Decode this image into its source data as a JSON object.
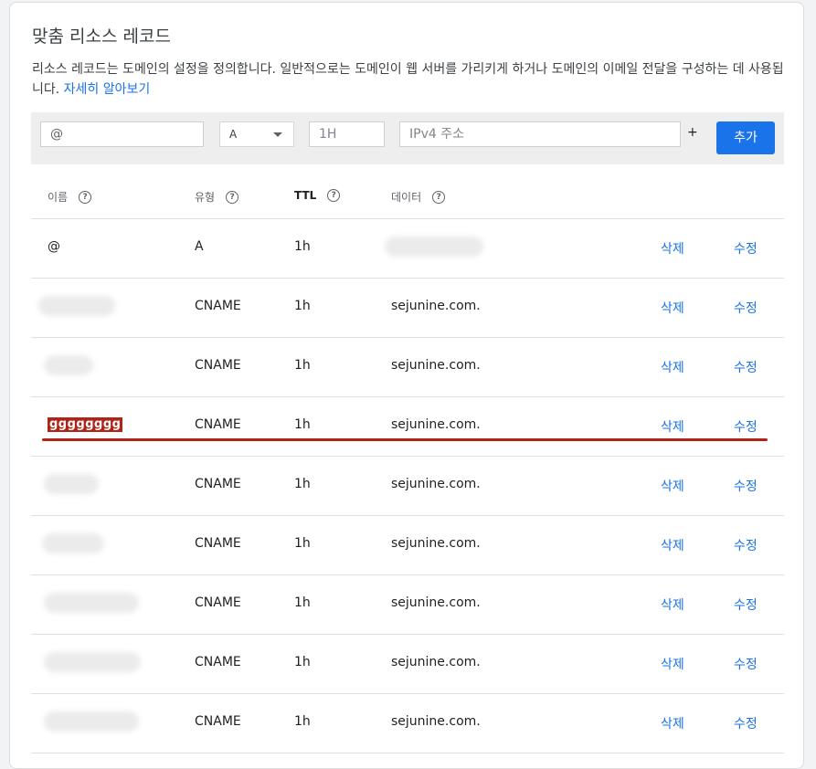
{
  "header": {
    "title": "맞춤 리소스 레코드",
    "description": "리소스 레코드는 도메인의 설정을 정의합니다. 일반적으로는 도메인이 웹 서버를 가리키게 하거나 도메인의 이메일 전달을 구성하는 데 사용됩니다.",
    "learn_more": "자세히 알아보기"
  },
  "form": {
    "name_value": "@",
    "type_value": "A",
    "ttl_placeholder": "1H",
    "data_placeholder": "IPv4 주소",
    "plus_label": "+",
    "add_label": "추가"
  },
  "columns": {
    "name": "이름",
    "type": "유형",
    "ttl": "TTL",
    "data": "데이터",
    "help_glyph": "?"
  },
  "actions": {
    "delete": "삭제",
    "edit": "수정"
  },
  "records": [
    {
      "name": "@",
      "type": "A",
      "ttl": "1h",
      "data": ""
    },
    {
      "name": "",
      "type": "CNAME",
      "ttl": "1h",
      "data": "sejunine.com."
    },
    {
      "name": "",
      "type": "CNAME",
      "ttl": "1h",
      "data": "sejunine.com."
    },
    {
      "name": "gggggggg",
      "type": "CNAME",
      "ttl": "1h",
      "data": "sejunine.com."
    },
    {
      "name": "",
      "type": "CNAME",
      "ttl": "1h",
      "data": "sejunine.com."
    },
    {
      "name": "",
      "type": "CNAME",
      "ttl": "1h",
      "data": "sejunine.com."
    },
    {
      "name": "",
      "type": "CNAME",
      "ttl": "1h",
      "data": "sejunine.com."
    },
    {
      "name": "",
      "type": "CNAME",
      "ttl": "1h",
      "data": "sejunine.com."
    },
    {
      "name": "",
      "type": "CNAME",
      "ttl": "1h",
      "data": "sejunine.com."
    }
  ],
  "colors": {
    "accent": "#1a73e8",
    "highlight": "#b02418"
  }
}
